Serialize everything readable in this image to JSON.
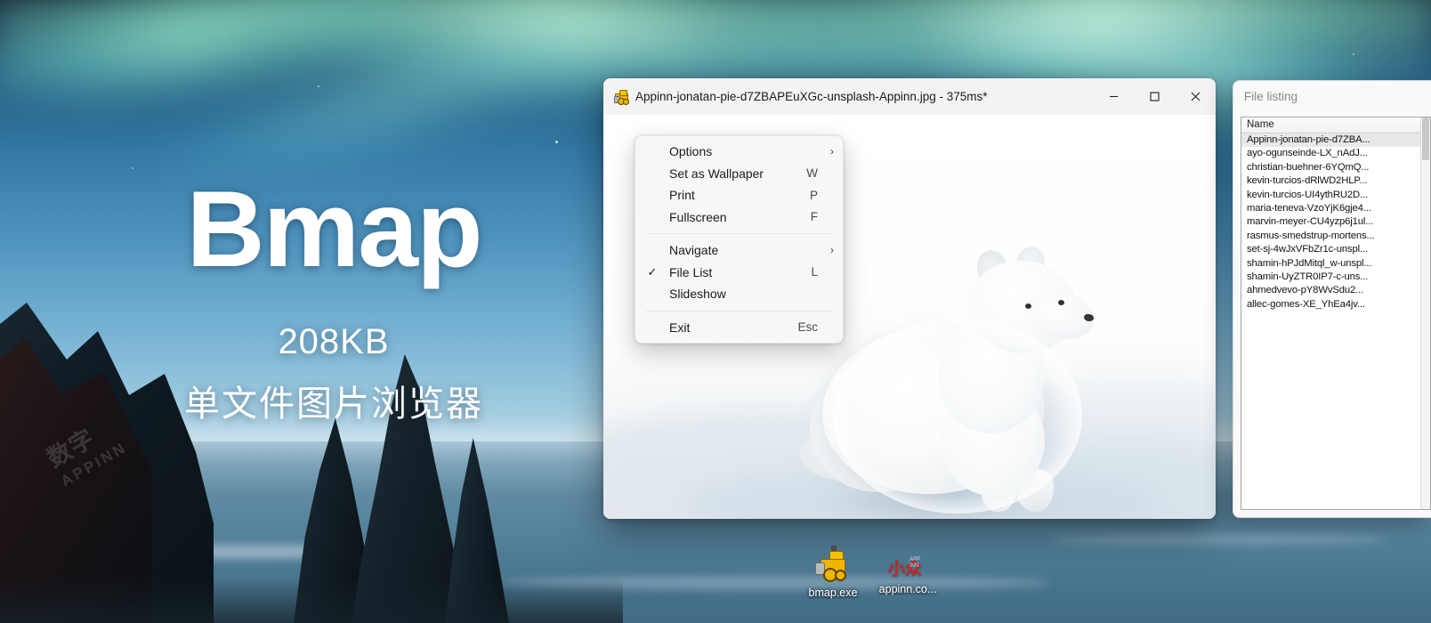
{
  "promo": {
    "title": "Bmap",
    "size": "208KB",
    "tagline": "单文件图片浏览器",
    "watermark_cn": "数字",
    "watermark_en": "APPINN"
  },
  "viewer_window": {
    "icon": "bulldozer-icon",
    "title": "Appinn-jonatan-pie-d7ZBAPEuXGc-unsplash-Appinn.jpg - 375ms*",
    "controls": {
      "minimize": "minimize-icon",
      "maximize": "maximize-icon",
      "close": "close-icon"
    }
  },
  "context_menu": {
    "items": [
      {
        "label": "Options",
        "accel": "",
        "arrow": "›",
        "checked": false,
        "separator_after": false
      },
      {
        "label": "Set as Wallpaper",
        "accel": "W",
        "arrow": "",
        "checked": false,
        "separator_after": false
      },
      {
        "label": "Print",
        "accel": "P",
        "arrow": "",
        "checked": false,
        "separator_after": false
      },
      {
        "label": "Fullscreen",
        "accel": "F",
        "arrow": "",
        "checked": false,
        "separator_after": true
      },
      {
        "label": "Navigate",
        "accel": "",
        "arrow": "›",
        "checked": false,
        "separator_after": false
      },
      {
        "label": "File List",
        "accel": "L",
        "arrow": "",
        "checked": true,
        "separator_after": false
      },
      {
        "label": "Slideshow",
        "accel": "",
        "arrow": "",
        "checked": false,
        "separator_after": true
      },
      {
        "label": "Exit",
        "accel": "Esc",
        "arrow": "",
        "checked": false,
        "separator_after": false
      }
    ],
    "check_glyph": "✓"
  },
  "file_listing": {
    "panel_title": "File listing",
    "column_header": "Name",
    "rows": [
      "Appinn-jonatan-pie-d7ZBA...",
      "ayo-ogunseinde-LX_nAdJ...",
      "christian-buehner-6YQmQ...",
      "kevin-turcios-dRlWD2HLP...",
      "kevin-turcios-UI4ythRU2D...",
      "maria-teneva-VzoYjK6gje4...",
      "marvin-meyer-CU4yzp6j1ul...",
      "rasmus-smedstrup-mortens...",
      "set-sj-4wJxVFbZr1c-unspl...",
      "shamin-hPJdMitql_w-unspl...",
      "shamin-UyZTR0IP7-c-uns...",
      "ahmedvevo-pY8WvSdu2...",
      "allec-gomes-XE_YhEa4jv..."
    ],
    "selected_index": 0
  },
  "desktop_icons": [
    {
      "name": "bmap-exe",
      "label": "bmap.exe",
      "glyph": "bulldozer-icon"
    },
    {
      "name": "appinn-shortcut",
      "label": "appinn.co...",
      "glyph": "appinn-logo-icon"
    }
  ],
  "colors": {
    "accent": "#0f6cbd",
    "close_hover": "#c42b1c",
    "menu_bg": "#f7f7f7",
    "title_bg": "#f3f3f3"
  }
}
